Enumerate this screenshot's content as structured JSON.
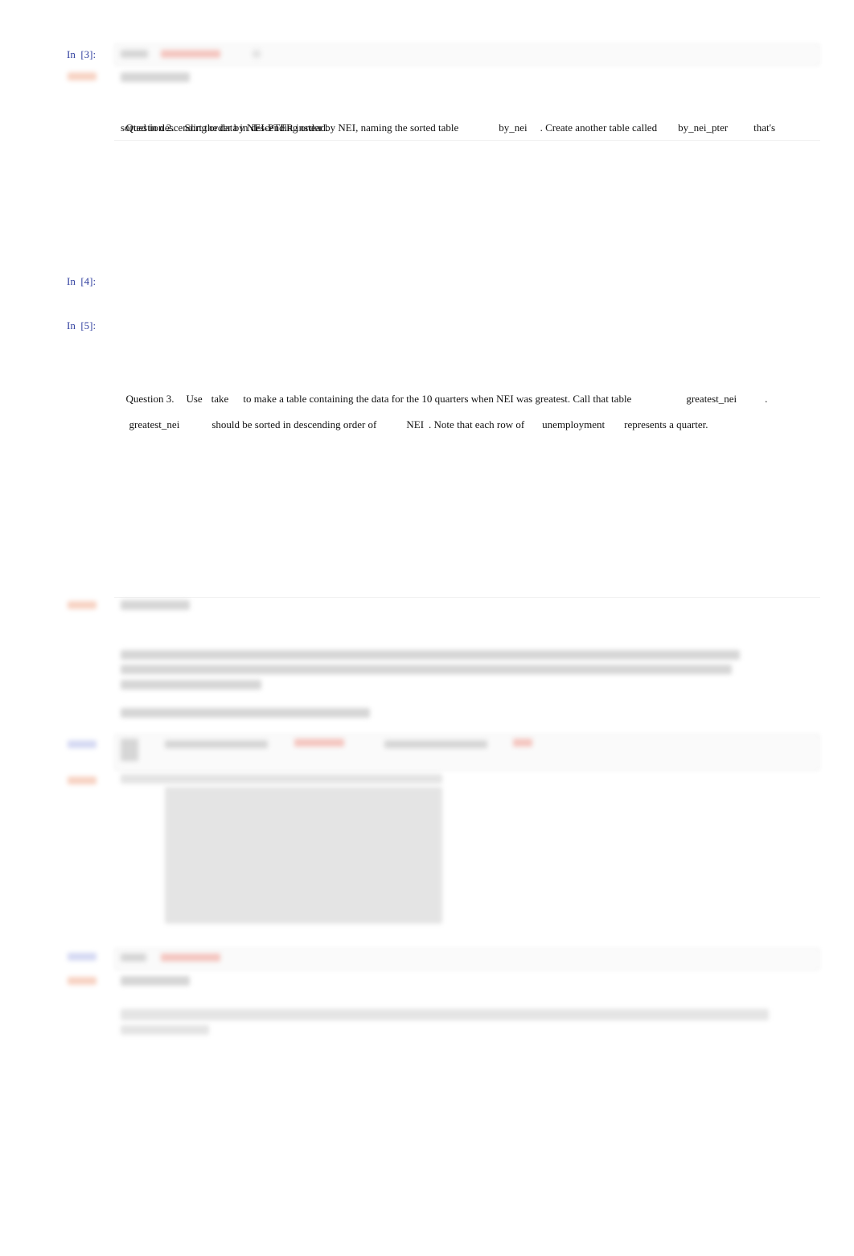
{
  "cells": {
    "in3": {
      "prompt": "In  [3]:"
    },
    "q2": {
      "line1": {
        "a": "Question 2.    Sort the data in descending order by NEI, naming the sorted table",
        "b": "by_nei",
        "c": ". Create another table called",
        "d": "by_nei_pter",
        "e": "that's"
      },
      "line2": "sorted in descending order by NEI-PTER instead."
    },
    "in4": {
      "prompt": "In  [4]:"
    },
    "in5": {
      "prompt": "In  [5]:"
    },
    "q3": {
      "line1": {
        "a": "Question 3.",
        "b": "Use",
        "c": "take",
        "d": "to make a table containing the data for the 10 quarters when NEI was greatest. Call that table",
        "e": "greatest_nei",
        "f": "."
      },
      "line2": {
        "a": "greatest_nei",
        "b": "should be sorted in descending order of",
        "c": "NEI",
        "d": ". Note that each row of",
        "e": "unemployment",
        "f": "represents a quarter."
      }
    }
  },
  "obscured_note": "Remaining cells are blurred and unreadable"
}
